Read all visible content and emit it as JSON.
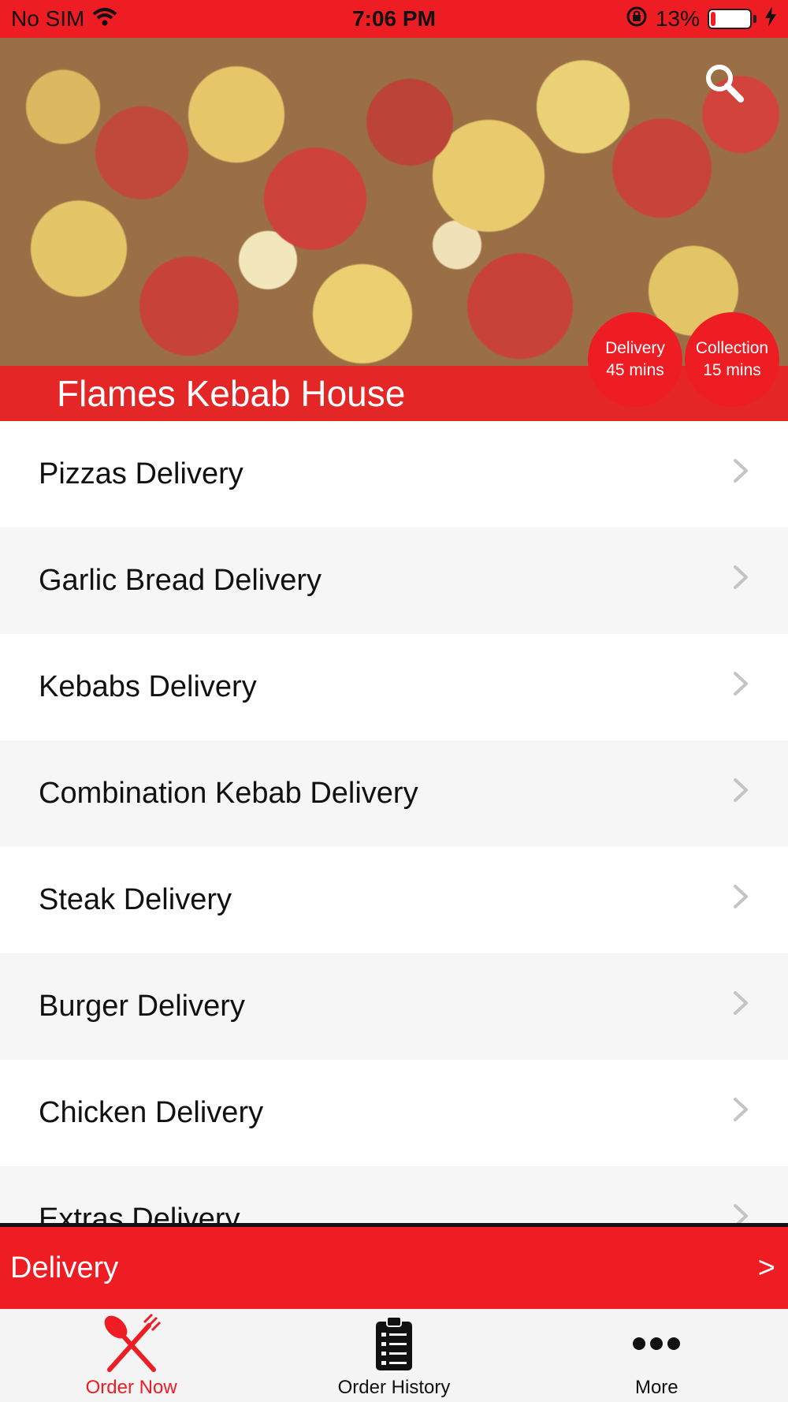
{
  "status_bar": {
    "carrier": "No SIM",
    "time": "7:06 PM",
    "battery": "13%",
    "battery_level": 0.13
  },
  "hero": {
    "restaurant_name": "Flames Kebab House",
    "delivery_badge": {
      "label": "Delivery",
      "time": "45 mins"
    },
    "collection_badge": {
      "label": "Collection",
      "time": "15 mins"
    },
    "search_icon": "search-icon"
  },
  "menu": {
    "items": [
      {
        "label": "Pizzas Delivery"
      },
      {
        "label": "Garlic Bread Delivery"
      },
      {
        "label": "Kebabs Delivery"
      },
      {
        "label": "Combination Kebab Delivery"
      },
      {
        "label": "Steak Delivery"
      },
      {
        "label": "Burger Delivery"
      },
      {
        "label": "Chicken Delivery"
      },
      {
        "label": "Extras Delivery"
      }
    ]
  },
  "delivery_bar": {
    "label": "Delivery",
    "arrow": ">"
  },
  "tabs": [
    {
      "label": "Order Now",
      "icon": "fork-knife-icon",
      "active": true
    },
    {
      "label": "Order History",
      "icon": "clipboard-icon",
      "active": false
    },
    {
      "label": "More",
      "icon": "more-dots-icon",
      "active": false
    }
  ],
  "colors": {
    "brand_red": "#ee1c23",
    "row_alt": "#f6f6f6",
    "tab_bar": "#f4f4f4"
  }
}
